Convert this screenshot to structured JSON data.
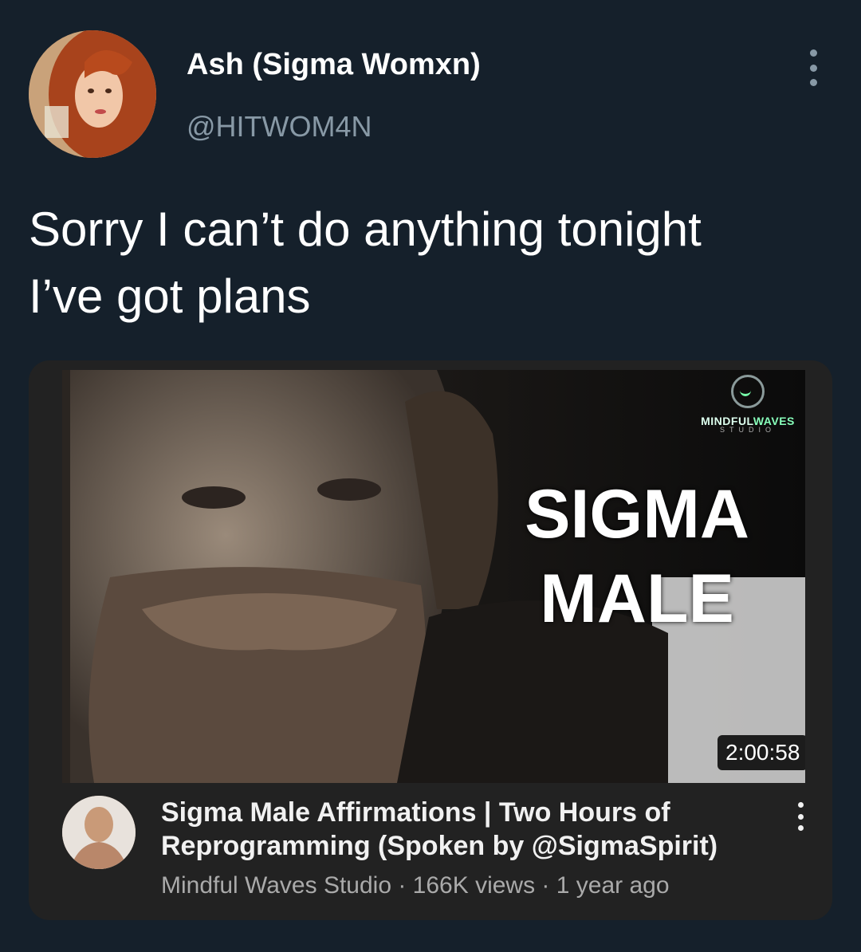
{
  "tweet": {
    "display_name": "Ash (Sigma Womxn)",
    "handle": "@HITWOM4N",
    "text_line1": "Sorry I can’t do anything tonight",
    "text_line2": "I’ve got plans",
    "more_icon": "more-vertical-icon"
  },
  "video_card": {
    "thumbnail": {
      "title_line1": "SIGMA",
      "title_line2": "MALE",
      "studio_logo_name_a": "MINDFUL",
      "studio_logo_name_b": "WAVES",
      "studio_logo_sub": "STUDIO",
      "duration": "2:00:58"
    },
    "title": "Sigma Male Affirmations | Two Hours of Reprogramming (Spoken by @SigmaSpirit)",
    "meta": "Mindful Waves Studio · 166K views · 1 year ago",
    "more_icon": "more-vertical-icon"
  }
}
